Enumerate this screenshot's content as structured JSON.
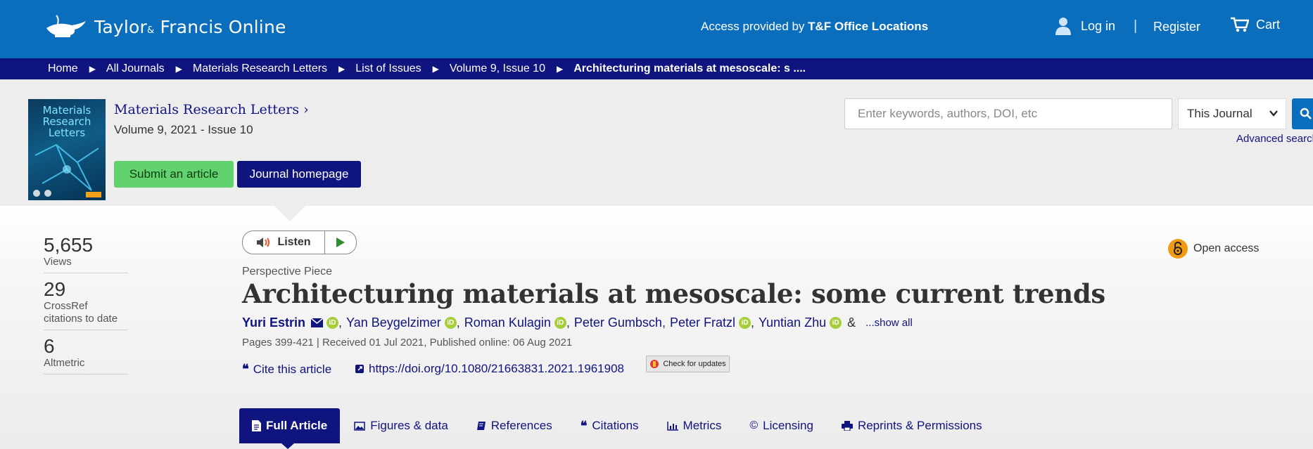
{
  "header": {
    "logo_text": "Taylor",
    "logo_amp": "&",
    "logo_text2": "Francis Online",
    "access_prefix": "Access provided by ",
    "access_org": "T&F Office Locations",
    "login": "Log in",
    "separator": "|",
    "register": "Register",
    "cart": "Cart"
  },
  "breadcrumb": [
    "Home",
    "All Journals",
    "Materials Research Letters",
    "List of Issues",
    "Volume 9, Issue 10",
    "Architecturing materials at mesoscale: s ...."
  ],
  "journal": {
    "cover_title": "Materials Research Letters",
    "title": "Materials Research Letters",
    "issue": "Volume 9, 2021 - Issue 10",
    "submit": "Submit an article",
    "homepage": "Journal homepage"
  },
  "search": {
    "placeholder": "Enter keywords, authors, DOI, etc",
    "scope": "This Journal",
    "advanced": "Advanced search"
  },
  "metrics": [
    {
      "value": "5,655",
      "label": "Views"
    },
    {
      "value": "29",
      "label": "CrossRef citations to date"
    },
    {
      "value": "6",
      "label": "Altmetric"
    }
  ],
  "listen": {
    "label": "Listen"
  },
  "open_access": "Open access",
  "article": {
    "type": "Perspective Piece",
    "title": "Architecturing materials at mesoscale: some current trends",
    "authors": [
      "Yuri Estrin",
      "Yan Beygelzimer",
      "Roman Kulagin",
      "Peter Gumbsch",
      "Peter Fratzl",
      "Yuntian Zhu"
    ],
    "amp": "&",
    "show_all": "...show all",
    "pages_info": "Pages 399-421 | Received 01 Jul 2021, Published online: 06 Aug 2021",
    "cite": "Cite this article",
    "doi": "https://doi.org/10.1080/21663831.2021.1961908",
    "check_updates": "Check for updates"
  },
  "tabs": [
    "Full Article",
    "Figures & data",
    "References",
    "Citations",
    "Metrics",
    "Licensing",
    "Reprints & Permissions"
  ],
  "colors": {
    "brand_blue": "#0a6ebd",
    "navy": "#10147e",
    "green": "#62d26f",
    "orcid": "#a6ce39",
    "open_access": "#f09b13"
  }
}
